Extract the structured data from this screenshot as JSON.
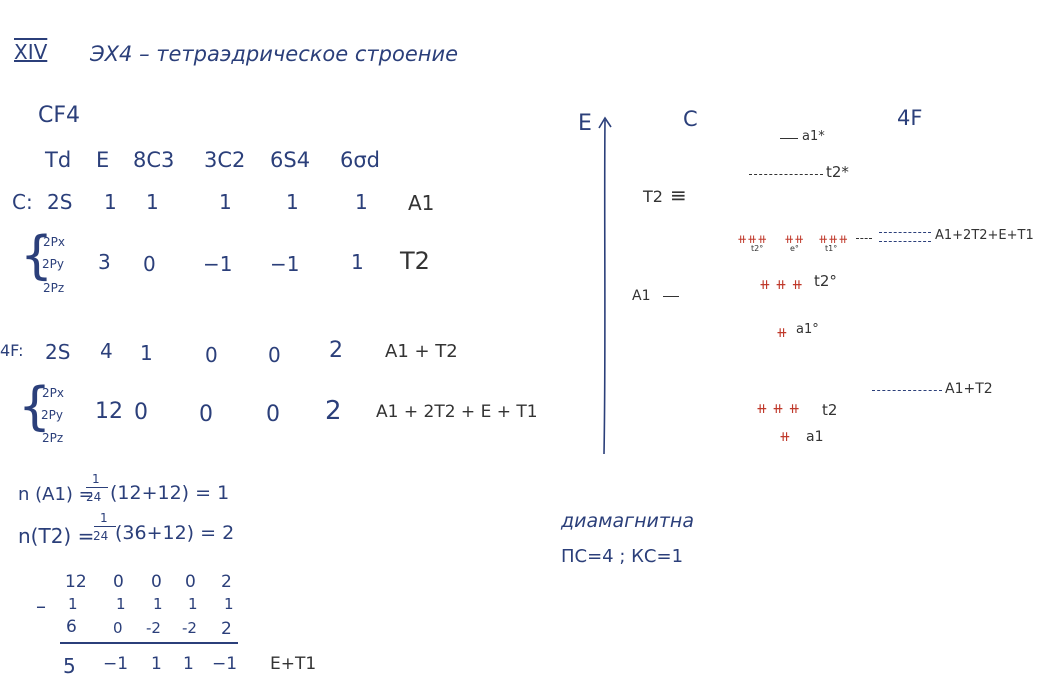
{
  "heading": {
    "roman": "XIV",
    "title": "ЭХ4 – тетраэдрическое строение",
    "molecule": "CF4"
  },
  "character_table": {
    "header": [
      "Td",
      "E",
      "8C3",
      "3C2",
      "6S4",
      "6σd"
    ],
    "c_rows": [
      {
        "label": "C:",
        "orbital": "2S",
        "values": [
          "1",
          "1",
          "1",
          "1",
          "1"
        ],
        "irrep": "A1"
      },
      {
        "orbitals": [
          "2Px",
          "2Py",
          "2Pz"
        ],
        "values": [
          "3",
          "0",
          "−1",
          "−1",
          "1"
        ],
        "irrep": "T2"
      }
    ],
    "f_rows": [
      {
        "label": "4F:",
        "orbital": "2S",
        "values": [
          "4",
          "1",
          "0",
          "0",
          "2"
        ],
        "irrep": "A1 + T2"
      },
      {
        "orbitals": [
          "2Px",
          "2Py",
          "2Pz"
        ],
        "values": [
          "12",
          "0",
          "0",
          "0",
          "2"
        ],
        "irrep": "A1 + 2T2 + E + T1"
      }
    ]
  },
  "formulas": {
    "nA1": {
      "lhs": "n (A1) =",
      "num": "1",
      "den": "24",
      "rhs": "(12+12) = 1"
    },
    "nT2": {
      "lhs": "n(T2) =",
      "num": "1",
      "den": "24",
      "rhs": "(36+12) = 2"
    }
  },
  "subtraction": {
    "minus": "–",
    "row1": [
      "12",
      "0",
      "0",
      "0",
      "2"
    ],
    "row2": [
      "1",
      "1",
      "1",
      "1",
      "1"
    ],
    "row3": [
      "6",
      "0",
      "-2",
      "-2",
      "2"
    ],
    "result": [
      "5",
      "−1",
      "1",
      "1",
      "−1"
    ],
    "result_label": "E+T1"
  },
  "mo_diagram": {
    "energy_label": "E",
    "left_header": "C",
    "right_header": "4F",
    "left_levels": {
      "t2": "T2",
      "a1": "A1"
    },
    "right_levels": {
      "upper": "A1+2T2+E+T1",
      "lower": "A1+T2"
    },
    "mo_labels": {
      "a1_star": "a1*",
      "t2_star": "t2*",
      "t2_zero_top_small": "t2°",
      "e_zero_small": "e°",
      "t1_zero_small": "t1°",
      "t2_zero": "t2°",
      "a1_zero": "a1°",
      "t2": "t2",
      "a1": "a1"
    }
  },
  "conclusion": {
    "magnetism": "диамагнитна",
    "counts": "ПС=4 ; КС=1"
  },
  "colors": {
    "ink_blue": "#2b3f7a",
    "ink_black": "#333333",
    "ink_red": "#c0392b"
  }
}
